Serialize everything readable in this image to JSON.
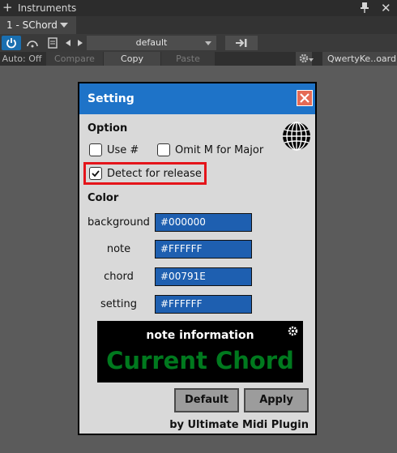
{
  "host": {
    "window_title": "Instruments",
    "tab_label": "1 - SChord",
    "preset_name": "default",
    "auto_label": "Auto: Off",
    "compare_label": "Compare",
    "copy_label": "Copy",
    "paste_label": "Paste",
    "device_label": "QwertyKe..oard"
  },
  "dialog": {
    "title": "Setting",
    "option_heading": "Option",
    "use_sharp": {
      "label": "Use #",
      "checked": false
    },
    "omit_m": {
      "label": "Omit M for Major",
      "checked": false
    },
    "detect_release": {
      "label": "Detect for release",
      "checked": true
    },
    "color_heading": "Color",
    "colors": [
      {
        "label": "background",
        "value": "#000000"
      },
      {
        "label": "note",
        "value": "#FFFFFF"
      },
      {
        "label": "chord",
        "value": "#00791E"
      },
      {
        "label": "setting",
        "value": "#FFFFFF"
      }
    ],
    "preview_note": "note information",
    "preview_chord": "Current Chord",
    "default_button": "Default",
    "apply_button": "Apply",
    "footer": "by Ultimate Midi Plugin"
  },
  "icons": [
    "plus-icon",
    "pin-icon",
    "close-icon",
    "power-icon",
    "bypass-icon",
    "document-icon",
    "prev-icon",
    "next-icon",
    "store-icon",
    "gear-icon",
    "globe-icon",
    "checkmark-icon"
  ],
  "colors": {
    "accent": "#1e73c8",
    "highlight": "#e4141a",
    "chord_green": "#00791E"
  }
}
